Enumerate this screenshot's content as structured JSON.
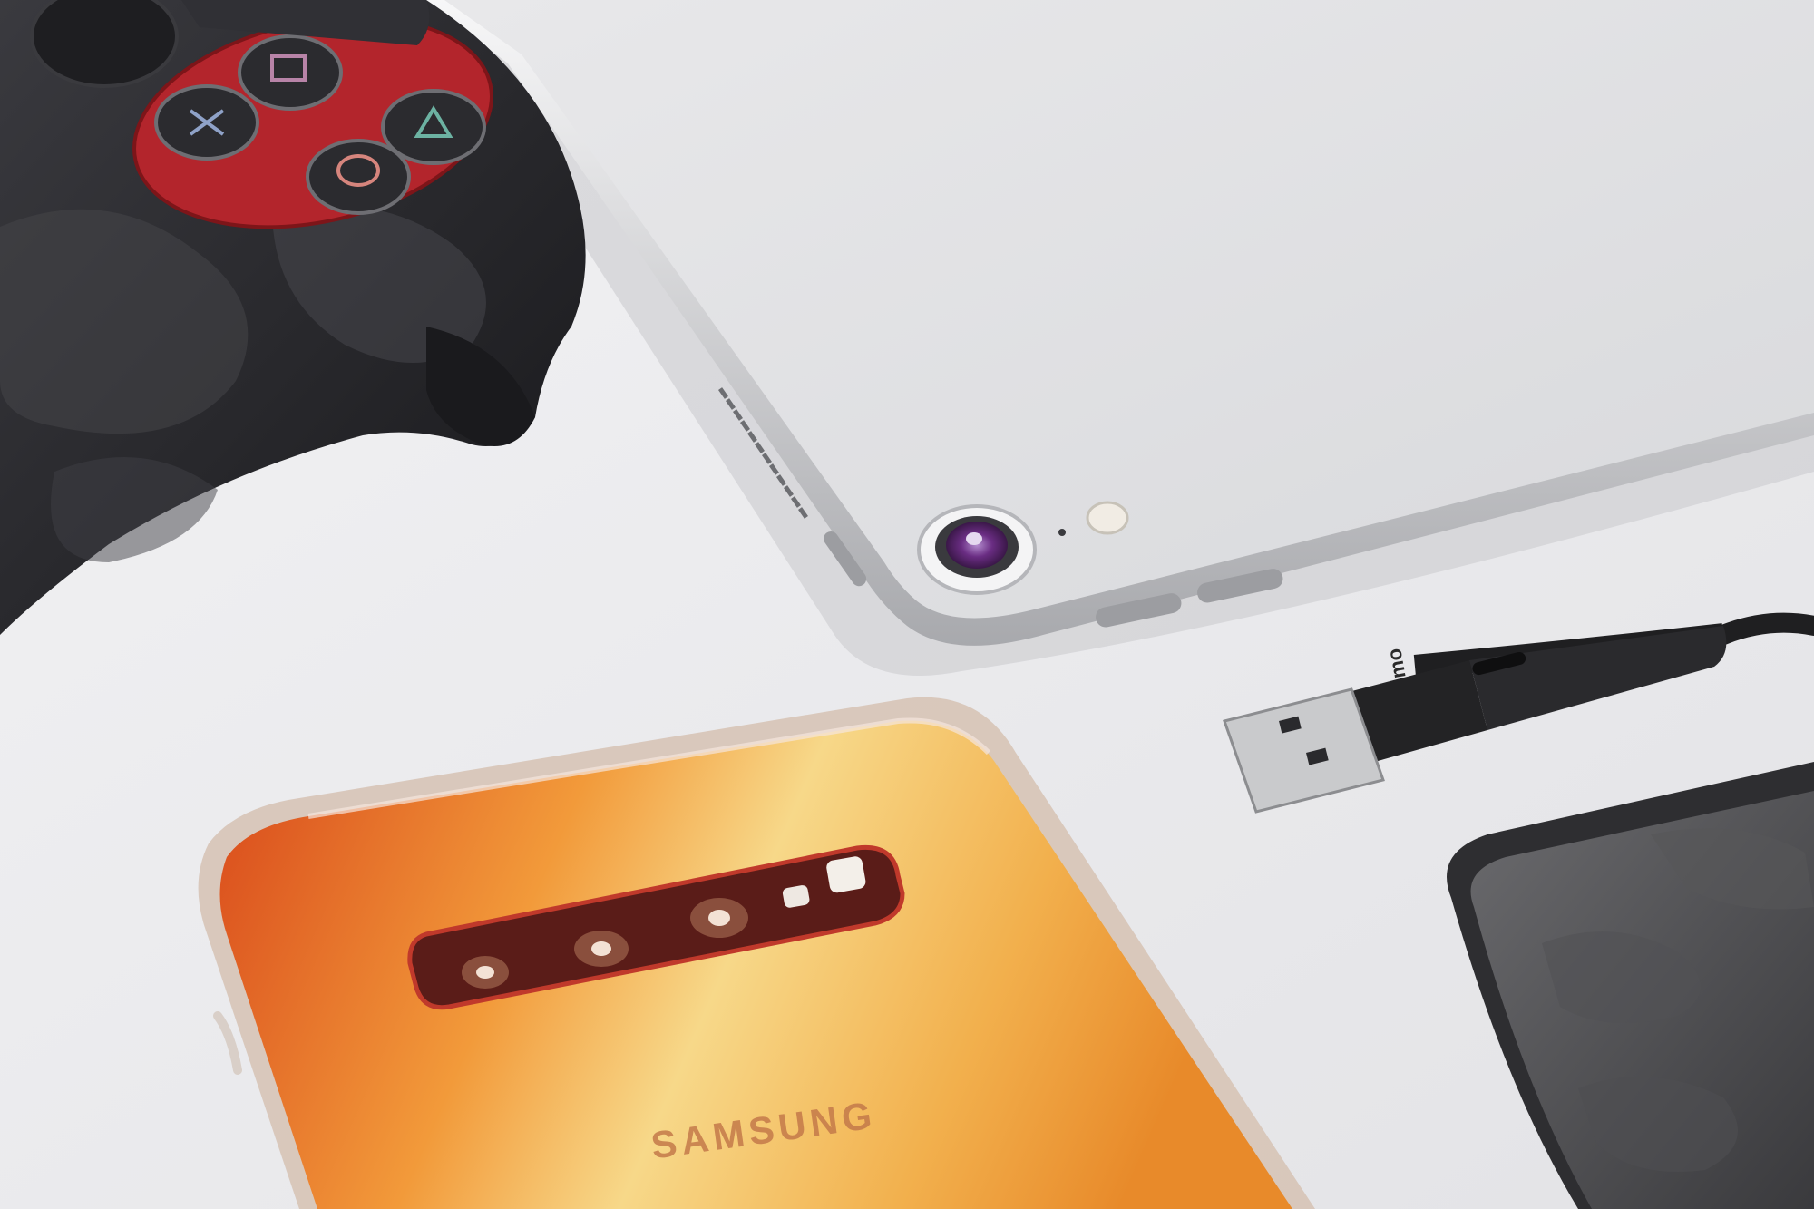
{
  "scene": {
    "description_labels": {
      "phone_brand": "SAMSUNG",
      "cable_brand": "mo"
    },
    "colors": {
      "background": "#e9e9eb",
      "controller_body": "#2a2a2e",
      "controller_accent": "#b8222a",
      "tablet_body": "#dcdde0",
      "tablet_camera": "#7a3a8a",
      "phone_gradient_start": "#e3641b",
      "phone_gradient_end": "#f4d27a",
      "cable": "#1f1f21"
    }
  }
}
